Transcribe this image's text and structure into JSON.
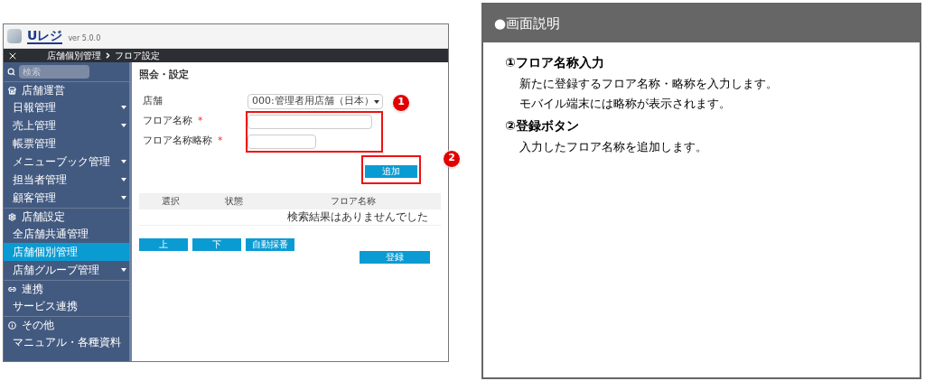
{
  "app": {
    "logo": "Uレジ",
    "version": "ver 5.0.0",
    "breadcrumb": [
      "店舗個別管理",
      "フロア設定"
    ]
  },
  "sidebar": {
    "search_placeholder": "検索",
    "items": [
      {
        "kind": "section",
        "label": "店舗運営"
      },
      {
        "kind": "item",
        "label": "日報管理",
        "has_submenu": true,
        "selected": false
      },
      {
        "kind": "item",
        "label": "売上管理",
        "has_submenu": true,
        "selected": false
      },
      {
        "kind": "item",
        "label": "帳票管理",
        "has_submenu": false,
        "selected": false
      },
      {
        "kind": "item",
        "label": "メニューブック管理",
        "has_submenu": true,
        "selected": false
      },
      {
        "kind": "item",
        "label": "担当者管理",
        "has_submenu": true,
        "selected": false
      },
      {
        "kind": "item",
        "label": "顧客管理",
        "has_submenu": true,
        "selected": false
      },
      {
        "kind": "section",
        "label": "店舗設定"
      },
      {
        "kind": "item",
        "label": "全店舗共通管理",
        "has_submenu": false,
        "selected": false
      },
      {
        "kind": "item",
        "label": "店舗個別管理",
        "has_submenu": false,
        "selected": true
      },
      {
        "kind": "item",
        "label": "店舗グループ管理",
        "has_submenu": true,
        "selected": false
      },
      {
        "kind": "section",
        "label": "連携"
      },
      {
        "kind": "item",
        "label": "サービス連携",
        "has_submenu": false,
        "selected": false
      },
      {
        "kind": "section",
        "label": "その他"
      },
      {
        "kind": "item",
        "label": "マニュアル・各種資料",
        "has_submenu": false,
        "selected": false
      }
    ]
  },
  "main": {
    "title": "照会・設定",
    "fields": [
      {
        "kind": "select",
        "label": "店舗",
        "value": "000:管理者用店舗（日本）"
      },
      {
        "kind": "text",
        "label": "フロア名称",
        "required_mark": "*"
      },
      {
        "kind": "short",
        "label": "フロア名称略称",
        "required_mark": "*"
      }
    ],
    "add_button": "追加",
    "table": {
      "columns": [
        "選択",
        "状態",
        "フロア名称"
      ],
      "empty_message": "検索結果はありませんでした"
    },
    "order_buttons": [
      "上",
      "下",
      "自動採番"
    ],
    "submit_button": "登録",
    "callouts": [
      "1",
      "2"
    ]
  },
  "explanation": {
    "title": "●画面説明",
    "sections": [
      {
        "heading": "①フロア名称入力",
        "paragraphs": [
          "新たに登録するフロア名称・略称を入力します。",
          "モバイル端末には略称が表示されます。"
        ]
      },
      {
        "heading": "②登録ボタン",
        "paragraphs": [
          "入力したフロア名称を追加します。"
        ]
      }
    ]
  }
}
